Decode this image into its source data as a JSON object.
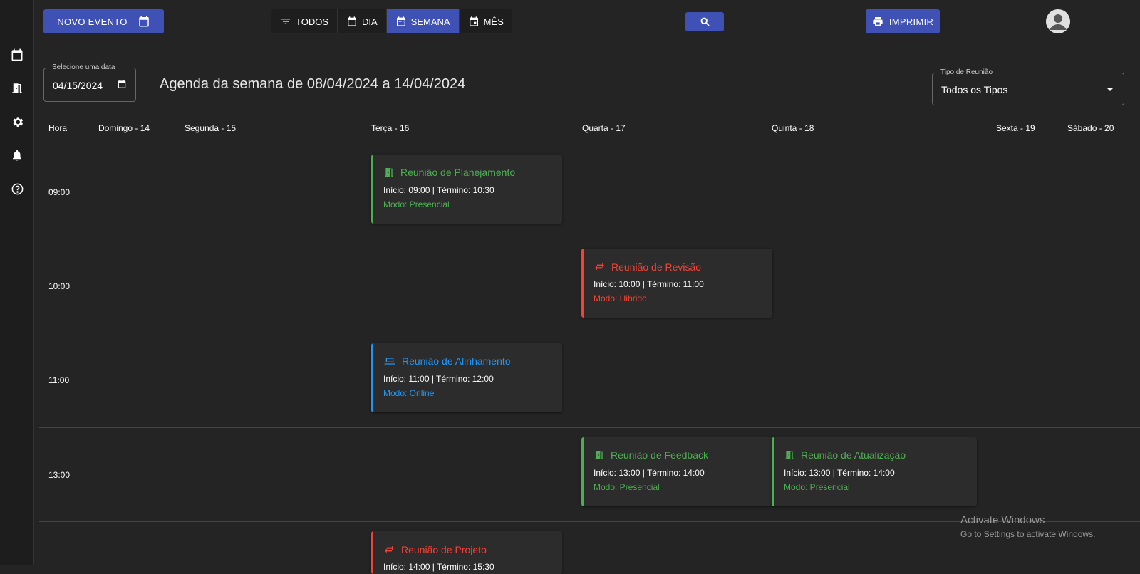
{
  "toolbar": {
    "new_event_label": "NOVO EVENTO",
    "views": [
      {
        "label": "TODOS",
        "icon": "filter-icon"
      },
      {
        "label": "DIA",
        "icon": "calendar-icon"
      },
      {
        "label": "SEMANA",
        "icon": "calendar-week-icon",
        "active": true
      },
      {
        "label": "MÊS",
        "icon": "calendar-month-icon"
      }
    ],
    "print_label": "IMPRIMIR"
  },
  "sidebar": {
    "items": [
      "calendar-icon",
      "door-icon",
      "gear-icon",
      "bell-icon",
      "help-icon"
    ]
  },
  "date_picker": {
    "label": "Selecione uma data",
    "value": "04/15/2024"
  },
  "week_title": "Agenda da semana de 08/04/2024 a 14/04/2024",
  "type_filter": {
    "label": "Tipo de Reunião",
    "value": "Todos os Tipos"
  },
  "columns": [
    "Hora",
    "Domingo - 14",
    "Segunda - 15",
    "Terça - 16",
    "Quarta - 17",
    "Quinta - 18",
    "Sexta - 19",
    "Sábado - 20"
  ],
  "hours": [
    "09:00",
    "10:00",
    "11:00",
    "13:00"
  ],
  "events": [
    {
      "title": "Reunião de Planejamento",
      "time": "Início: 09:00 | Término: 10:30",
      "mode": "Modo: Presencial",
      "color": "#4caf50",
      "icon": "door-icon"
    },
    {
      "title": "Reunião de Revisão",
      "time": "Início: 10:00 | Término: 11:00",
      "mode": "Modo: Hibrido",
      "color": "#f44336",
      "icon": "swap-icon"
    },
    {
      "title": "Reunião de Alinhamento",
      "time": "Início: 11:00 | Término: 12:00",
      "mode": "Modo: Online",
      "color": "#2196f3",
      "icon": "laptop-icon"
    },
    {
      "title": "Reunião de Feedback",
      "time": "Início: 13:00 | Término: 14:00",
      "mode": "Modo: Presencial",
      "color": "#4caf50",
      "icon": "door-icon"
    },
    {
      "title": "Reunião de Atualização",
      "time": "Início: 13:00 | Término: 14:00",
      "mode": "Modo: Presencial",
      "color": "#4caf50",
      "icon": "door-icon"
    },
    {
      "title": "Reunião de Projeto",
      "time": "Início: 14:00 | Término: 15:30",
      "mode": "",
      "color": "#f44336",
      "icon": "swap-icon"
    }
  ],
  "watermark": {
    "line1": "Activate Windows",
    "line2": "Go to Settings to activate Windows."
  }
}
